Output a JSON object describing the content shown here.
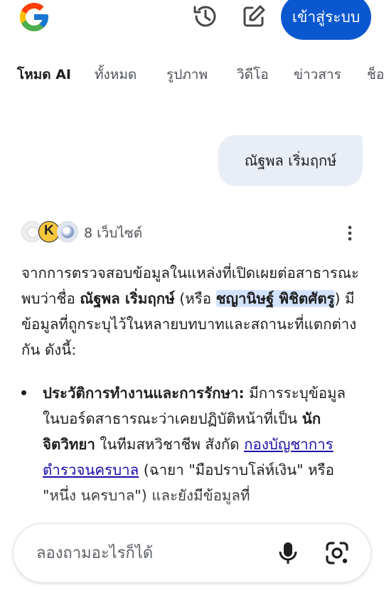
{
  "header": {
    "logo_icon": "google-g-icon",
    "history_icon": "history-icon",
    "edit_icon": "edit-icon",
    "signin_label": "เข้าสู่ระบบ"
  },
  "tabs": [
    {
      "label": "โหมด AI",
      "active": true
    },
    {
      "label": "ทั้งหมด"
    },
    {
      "label": "รูปภาพ"
    },
    {
      "label": "วิดีโอ"
    },
    {
      "label": "ข่าวสาร"
    },
    {
      "label": "ช็อ"
    }
  ],
  "query_bubble": "ณัฐพล เริ่มฤกษ์",
  "sources": {
    "count_label": "8 เว็บไซต์",
    "k_letter": "K"
  },
  "answer": {
    "p1_a": "จากการตรวจสอบข้อมูลในแหล่งที่เปิดเผยต่อสาธารณะ พบว่าชื่อ ",
    "p1_name": "ณัฐพล เริ่มฤกษ์",
    "p1_b": " (หรือ ",
    "p1_alt_name": "ชญานิษฐ์ พิชิตศัตรู",
    "p1_c": ") มีข้อมูลที่ถูกระบุไว้ในหลายบทบาทและสถานะที่แตกต่างกัน ดังนี้:",
    "bullet_title": "ประวัติการทำงานและการรักษา:",
    "bullet_a": " มีการระบุข้อมูลในบอร์ดสาธารณะว่าเคยปฏิบัติหน้าที่เป็น ",
    "bullet_role": "นักจิตวิทยา",
    "bullet_b": " ในทีมสหวิชาชีพ สังกัด ",
    "bullet_link": "กองบัญชาการตำรวจนครบาล",
    "bullet_c": " (ฉายา \"มือปราบโล่ห์เงิน\" หรือ \"หนึ่ง นครบาล\") และยังมีข้อมูลที่"
  },
  "search": {
    "placeholder": "ลองถามอะไรก็ได้",
    "mic_icon": "microphone-icon",
    "lens_icon": "google-lens-icon"
  }
}
